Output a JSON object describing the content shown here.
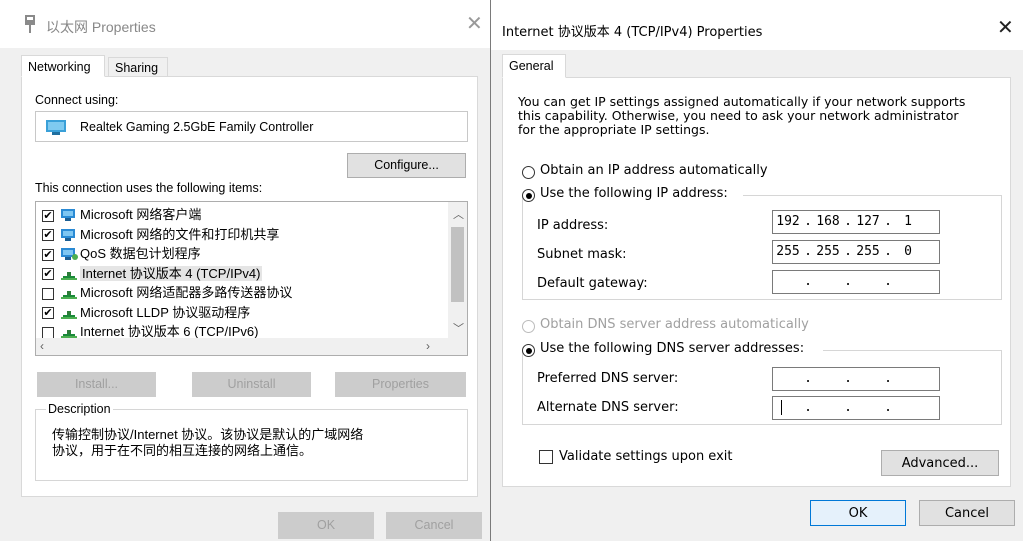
{
  "left_dialog": {
    "title": "以太网 Properties",
    "tabs": [
      "Networking",
      "Sharing"
    ],
    "connect_using_label": "Connect using:",
    "adapter_name": "Realtek Gaming 2.5GbE Family Controller",
    "configure_label": "Configure...",
    "items_label": "This connection uses the following items:",
    "items": [
      {
        "label": "Microsoft 网络客户端",
        "checked": true,
        "icon": "network-client-icon"
      },
      {
        "label": "Microsoft 网络的文件和打印机共享",
        "checked": true,
        "icon": "file-share-icon"
      },
      {
        "label": "QoS 数据包计划程序",
        "checked": true,
        "icon": "qos-icon"
      },
      {
        "label": "Internet 协议版本 4 (TCP/IPv4)",
        "checked": true,
        "icon": "protocol-icon"
      },
      {
        "label": "Microsoft 网络适配器多路传送器协议",
        "checked": false,
        "icon": "protocol-icon"
      },
      {
        "label": "Microsoft LLDP 协议驱动程序",
        "checked": true,
        "icon": "protocol-icon"
      },
      {
        "label": "Internet 协议版本 6 (TCP/IPv6)",
        "checked": false,
        "icon": "protocol-icon"
      }
    ],
    "install_label": "Install...",
    "uninstall_label": "Uninstall",
    "properties_label": "Properties",
    "description_label": "Description",
    "description_text_line1": "传输控制协议/Internet 协议。该协议是默认的广域网络",
    "description_text_line2": "协议，用于在不同的相互连接的网络上通信。",
    "ok_label": "OK",
    "cancel_label": "Cancel"
  },
  "right_dialog": {
    "title": "Internet 协议版本 4 (TCP/IPv4) Properties",
    "tab": "General",
    "intro_line1": "You can get IP settings assigned automatically if your network supports",
    "intro_line2": "this capability. Otherwise, you need to ask your network administrator",
    "intro_line3": "for the appropriate IP settings.",
    "obtain_ip_auto": "Obtain an IP address automatically",
    "use_following_ip": "Use the following IP address:",
    "ip_address_label": "IP address:",
    "ip_address": [
      "192",
      "168",
      "127",
      "1"
    ],
    "subnet_mask_label": "Subnet mask:",
    "subnet_mask": [
      "255",
      "255",
      "255",
      "0"
    ],
    "default_gateway_label": "Default gateway:",
    "obtain_dns_auto": "Obtain DNS server address automatically",
    "use_following_dns": "Use the following DNS server addresses:",
    "preferred_dns_label": "Preferred DNS server:",
    "alternate_dns_label": "Alternate DNS server:",
    "validate_label": "Validate settings upon exit",
    "advanced_label": "Advanced...",
    "ok_label": "OK",
    "cancel_label": "Cancel",
    "ip_mode": "manual",
    "dns_mode": "manual"
  },
  "colors": {
    "accent": "#0078d7",
    "dialog_bg": "#f0f0f0",
    "disabled_text": "#a0a0a0"
  }
}
